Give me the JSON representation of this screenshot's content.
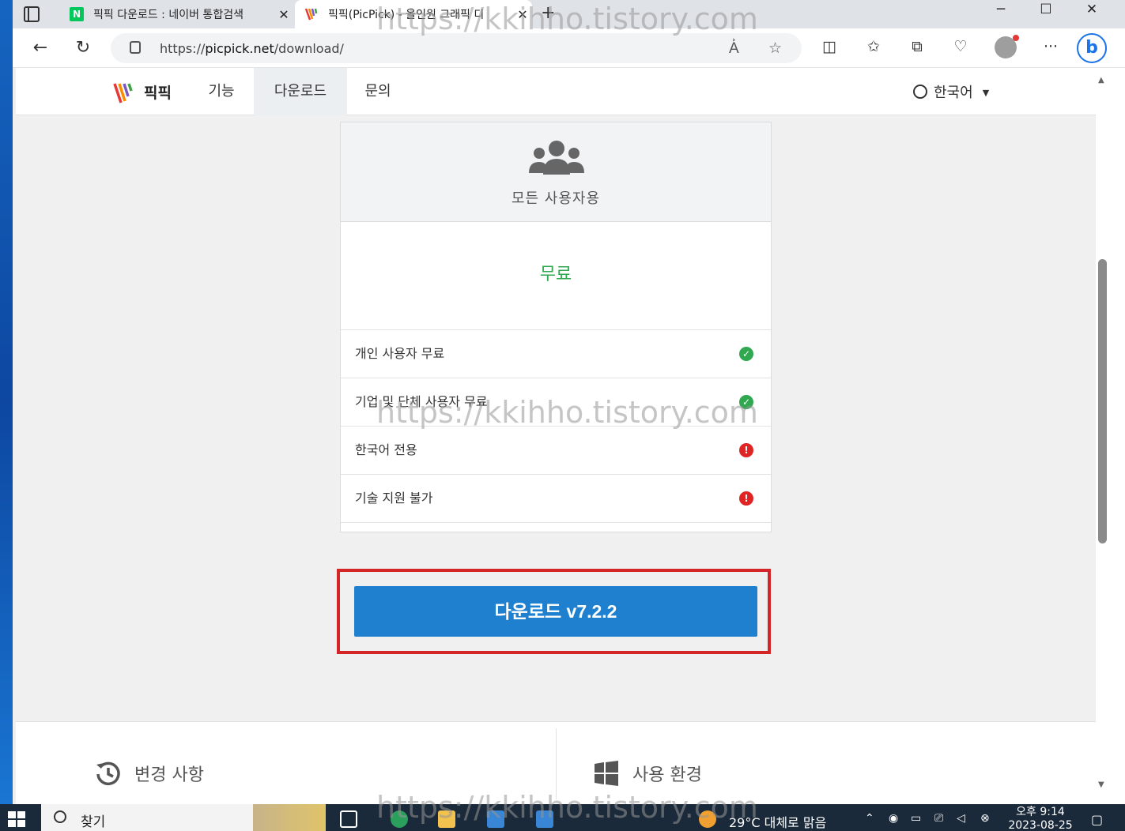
{
  "browser": {
    "tabs": [
      {
        "title": "픽픽 다운로드 : 네이버 통합검색",
        "favicon": "naver-icon"
      },
      {
        "title": "픽픽(PicPick) - 올인원 그래픽 디",
        "favicon": "picpick-icon"
      }
    ],
    "url_prefix": "https://",
    "url_host": "picpick.net",
    "url_path": "/download/"
  },
  "site": {
    "brand": "픽픽",
    "nav": [
      {
        "label": "기능"
      },
      {
        "label": "다운로드"
      },
      {
        "label": "문의"
      }
    ],
    "language": "한국어"
  },
  "plan": {
    "audience": "모든 사용자용",
    "price": "무료",
    "features": [
      {
        "label": "개인 사용자 무료",
        "status": "ok"
      },
      {
        "label": "기업 및 단체 사용자 무료",
        "status": "ok"
      },
      {
        "label": "한국어 전용",
        "status": "no"
      },
      {
        "label": "기술 지원 불가",
        "status": "no"
      }
    ],
    "download_label": "다운로드 v7.2.2"
  },
  "bottom": {
    "changelog": "변경 사항",
    "requirements": "사용 환경"
  },
  "taskbar": {
    "search_label": "찾기",
    "weather": "29°C 대체로 맑음",
    "time": "오후 9:14",
    "date": "2023-08-25"
  },
  "watermark": "https://kkihho.tistory.com",
  "colors": {
    "accent_blue": "#2080d0",
    "price_green": "#2fa84f",
    "highlight_red": "#d42528",
    "error_red": "#e02424"
  }
}
